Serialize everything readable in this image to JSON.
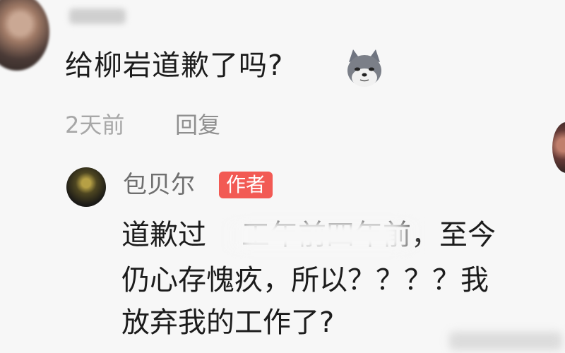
{
  "top_comment": {
    "text": "给柳岩道歉了吗?",
    "time": "2天前",
    "reply_label": "回复"
  },
  "author_reply": {
    "username": "包贝尔",
    "badge": "作者",
    "lines": [
      "道歉过",
      "工年前四年前，至今",
      "仍心存愧疚，所以？？？？我",
      "放弃我的工作了?"
    ]
  },
  "icons": {
    "emoji": "doge-emoji-icon"
  },
  "colors": {
    "badge_bg": "#f25a54",
    "meta_text": "#a7a7a7",
    "author_name": "#6f6f6f"
  }
}
